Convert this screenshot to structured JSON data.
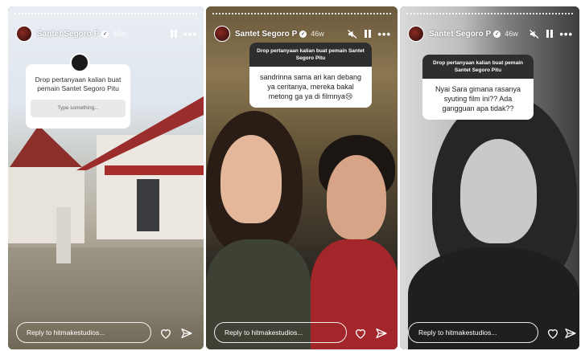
{
  "stories": [
    {
      "username": "Santet Segoro P",
      "time": "46w",
      "sticker": {
        "title": "Drop pertanyaan kalian buat pemain Santet Segoro Pitu",
        "input_placeholder": "Type something..."
      },
      "reply_placeholder": "Reply to hitmakestudios..."
    },
    {
      "username": "Santet Segoro P",
      "time": "46w",
      "sticker": {
        "title": "Drop pertanyaan kalian buat pemain Santet Segoro Pitu",
        "answer": "sandrinna sama ari kan debang ya ceritanya, mereka bakal metong ga ya di filmnya😢"
      },
      "reply_placeholder": "Reply to hitmakestudios..."
    },
    {
      "username": "Santet Segoro P",
      "time": "46w",
      "sticker": {
        "title": "Drop pertanyaan kalian buat pemain Santet Segoro Pitu",
        "answer": "Nyai Sara gimana rasanya syuting film ini?? Ada gangguan apa tidak??"
      },
      "reply_placeholder": "Reply to hitmakestudios..."
    }
  ],
  "colors": {
    "roof": "#9b2e2c",
    "sticker_header": "#2e2e2e",
    "text_white": "#ffffff"
  },
  "icons": {
    "verified": "verified-badge-icon",
    "pause": "pause-icon",
    "more": "more-options-icon",
    "mute": "muted-speaker-icon",
    "like": "heart-icon",
    "share": "send-icon"
  }
}
